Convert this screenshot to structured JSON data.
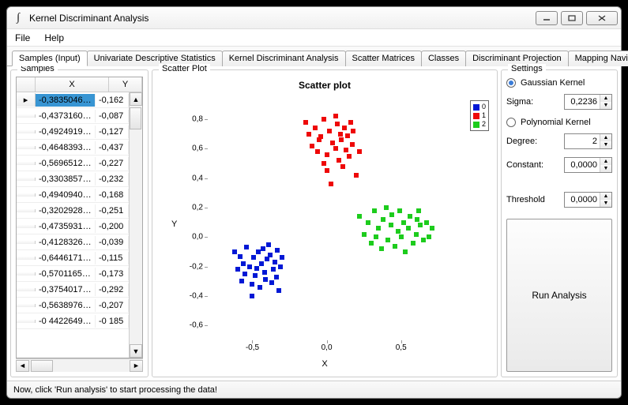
{
  "window": {
    "title": "Kernel Discriminant Analysis"
  },
  "menu": {
    "file": "File",
    "help": "Help"
  },
  "tabs": [
    {
      "label": "Samples (Input)",
      "active": true
    },
    {
      "label": "Univariate Descriptive Statistics"
    },
    {
      "label": "Kernel Discriminant Analysis"
    },
    {
      "label": "Scatter Matrices"
    },
    {
      "label": "Classes"
    },
    {
      "label": "Discriminant Projection"
    },
    {
      "label": "Mapping Navigation"
    }
  ],
  "samples": {
    "title": "Samples",
    "cols": {
      "x": "X",
      "y": "Y"
    },
    "rows": [
      {
        "x": "-0,38350464894...",
        "y": "-0,162",
        "sel": true,
        "ptr": true
      },
      {
        "x": "-0,43731609173...",
        "y": "-0,087"
      },
      {
        "x": "-0,49249198453...",
        "y": "-0,127"
      },
      {
        "x": "-0,46483930972...",
        "y": "-0,437"
      },
      {
        "x": "-0,56965125351...",
        "y": "-0,227"
      },
      {
        "x": "-0,33038575192...",
        "y": "-0,232"
      },
      {
        "x": "-0,49409402220...",
        "y": "-0,168"
      },
      {
        "x": "-0,32029282163...",
        "y": "-0,251"
      },
      {
        "x": "-0,47359314711...",
        "y": "-0,200"
      },
      {
        "x": "-0,41283267113...",
        "y": "-0,039"
      },
      {
        "x": "-0,64461715393...",
        "y": "-0,115"
      },
      {
        "x": "-0,57011653456...",
        "y": "-0,173"
      },
      {
        "x": "-0,37540178795...",
        "y": "-0,292"
      },
      {
        "x": "-0,56389769950...",
        "y": "-0,207"
      },
      {
        "x": "-0 44226497812",
        "y": "-0 185"
      }
    ]
  },
  "scatter": {
    "title": "Scatter Plot"
  },
  "chart_data": {
    "type": "scatter",
    "title": "Scatter plot",
    "xlabel": "X",
    "ylabel": "Y",
    "xlim": [
      -0.8,
      0.9
    ],
    "ylim": [
      -0.7,
      0.95
    ],
    "xticks": [
      -0.5,
      0.0,
      0.5
    ],
    "yticks": [
      -0.6,
      -0.4,
      -0.2,
      0.0,
      0.2,
      0.4,
      0.6,
      0.8
    ],
    "legend": [
      "0",
      "1",
      "2"
    ],
    "colors": [
      "#0018d5",
      "#ee0808",
      "#1dcc1d"
    ],
    "series": [
      {
        "name": "0",
        "cls": 0,
        "points": [
          [
            -0.62,
            -0.1
          ],
          [
            -0.6,
            -0.22
          ],
          [
            -0.58,
            -0.13
          ],
          [
            -0.57,
            -0.3
          ],
          [
            -0.56,
            -0.18
          ],
          [
            -0.55,
            -0.25
          ],
          [
            -0.54,
            -0.07
          ],
          [
            -0.52,
            -0.2
          ],
          [
            -0.5,
            -0.32
          ],
          [
            -0.49,
            -0.14
          ],
          [
            -0.48,
            -0.26
          ],
          [
            -0.47,
            -0.21
          ],
          [
            -0.46,
            -0.1
          ],
          [
            -0.45,
            -0.34
          ],
          [
            -0.44,
            -0.18
          ],
          [
            -0.43,
            -0.08
          ],
          [
            -0.42,
            -0.24
          ],
          [
            -0.41,
            -0.29
          ],
          [
            -0.4,
            -0.15
          ],
          [
            -0.39,
            -0.05
          ],
          [
            -0.38,
            -0.12
          ],
          [
            -0.37,
            -0.31
          ],
          [
            -0.36,
            -0.22
          ],
          [
            -0.35,
            -0.17
          ],
          [
            -0.34,
            -0.27
          ],
          [
            -0.33,
            -0.09
          ],
          [
            -0.32,
            -0.36
          ],
          [
            -0.31,
            -0.2
          ],
          [
            -0.3,
            -0.14
          ],
          [
            -0.5,
            -0.4
          ]
        ]
      },
      {
        "name": "1",
        "cls": 1,
        "points": [
          [
            -0.14,
            0.78
          ],
          [
            -0.12,
            0.7
          ],
          [
            -0.1,
            0.62
          ],
          [
            -0.08,
            0.74
          ],
          [
            -0.06,
            0.58
          ],
          [
            -0.04,
            0.68
          ],
          [
            -0.02,
            0.8
          ],
          [
            0.0,
            0.56
          ],
          [
            0.02,
            0.72
          ],
          [
            0.04,
            0.64
          ],
          [
            0.06,
            0.6
          ],
          [
            0.07,
            0.77
          ],
          [
            0.08,
            0.52
          ],
          [
            0.09,
            0.7
          ],
          [
            0.1,
            0.66
          ],
          [
            0.11,
            0.48
          ],
          [
            0.12,
            0.74
          ],
          [
            0.13,
            0.59
          ],
          [
            0.14,
            0.69
          ],
          [
            0.15,
            0.55
          ],
          [
            0.16,
            0.78
          ],
          [
            0.17,
            0.63
          ],
          [
            0.18,
            0.72
          ],
          [
            0.2,
            0.42
          ],
          [
            0.22,
            0.58
          ],
          [
            0.03,
            0.36
          ],
          [
            -0.02,
            0.5
          ],
          [
            -0.05,
            0.66
          ],
          [
            0.06,
            0.82
          ],
          [
            0.0,
            0.45
          ]
        ]
      },
      {
        "name": "2",
        "cls": 2,
        "points": [
          [
            0.22,
            0.14
          ],
          [
            0.25,
            0.02
          ],
          [
            0.28,
            0.1
          ],
          [
            0.3,
            -0.04
          ],
          [
            0.32,
            0.18
          ],
          [
            0.33,
            0.0
          ],
          [
            0.35,
            0.06
          ],
          [
            0.37,
            -0.08
          ],
          [
            0.38,
            0.12
          ],
          [
            0.4,
            0.2
          ],
          [
            0.41,
            -0.02
          ],
          [
            0.43,
            0.08
          ],
          [
            0.44,
            0.15
          ],
          [
            0.46,
            -0.06
          ],
          [
            0.48,
            0.04
          ],
          [
            0.49,
            0.18
          ],
          [
            0.5,
            0.0
          ],
          [
            0.52,
            0.1
          ],
          [
            0.53,
            -0.1
          ],
          [
            0.55,
            0.06
          ],
          [
            0.56,
            0.14
          ],
          [
            0.58,
            -0.04
          ],
          [
            0.6,
            0.02
          ],
          [
            0.61,
            0.12
          ],
          [
            0.63,
            0.08
          ],
          [
            0.65,
            -0.02
          ],
          [
            0.67,
            0.1
          ],
          [
            0.69,
            0.0
          ],
          [
            0.71,
            0.06
          ],
          [
            0.62,
            0.18
          ]
        ]
      }
    ]
  },
  "settings": {
    "title": "Settings",
    "gaussian": {
      "label": "Gaussian Kernel",
      "checked": true,
      "sigma_label": "Sigma:",
      "sigma": "0,2236"
    },
    "polynomial": {
      "label": "Polynomial Kernel",
      "checked": false,
      "degree_label": "Degree:",
      "degree": "2",
      "constant_label": "Constant:",
      "constant": "0,0000"
    },
    "threshold": {
      "label": "Threshold",
      "value": "0,0000"
    },
    "run": "Run Analysis"
  },
  "status": "Now, click 'Run analysis' to start processing the data!"
}
